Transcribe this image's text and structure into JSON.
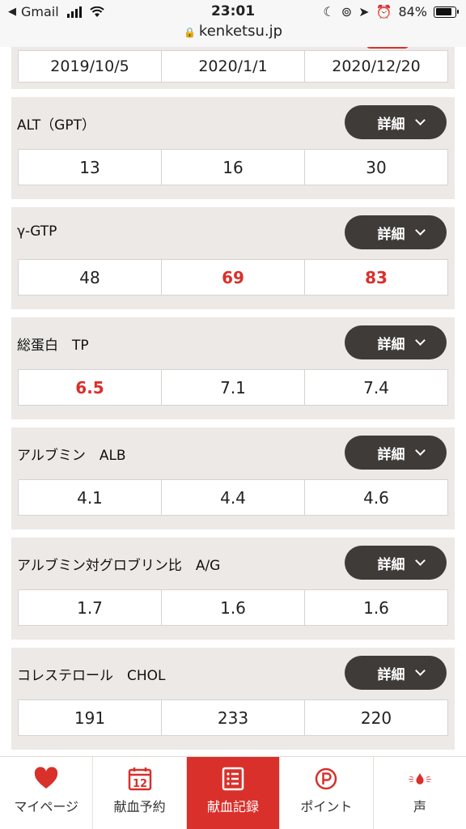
{
  "status": {
    "back_app": "Gmail",
    "time": "23:01",
    "battery": "84%"
  },
  "browser": {
    "url": "kenketsu.jp"
  },
  "dates": [
    "2019/10/5",
    "2020/1/1",
    "2020/12/20"
  ],
  "detail_label": "詳細",
  "metrics": [
    {
      "name": "ALT（GPT）",
      "values": [
        "13",
        "16",
        "30"
      ]
    },
    {
      "name": "γ-GTP",
      "values": [
        "48",
        "69",
        "83"
      ]
    },
    {
      "name": "総蛋白　TP",
      "values": [
        "6.5",
        "7.1",
        "7.4"
      ]
    },
    {
      "name": "アルブミン　ALB",
      "values": [
        "4.1",
        "4.4",
        "4.6"
      ]
    },
    {
      "name": "アルブミン対グロブリン比　A/G",
      "values": [
        "1.7",
        "1.6",
        "1.6"
      ]
    },
    {
      "name": "コレステロール　CHOL",
      "values": [
        "191",
        "233",
        "220"
      ]
    }
  ],
  "nav": {
    "mypage": "マイページ",
    "reservation": "献血予約",
    "calendar_day": "12",
    "records": "献血記録",
    "points": "ポイント",
    "voice": "声"
  },
  "colors": {
    "accent": "#d9302b",
    "button": "#3f3b39",
    "card": "#ece9e6"
  }
}
